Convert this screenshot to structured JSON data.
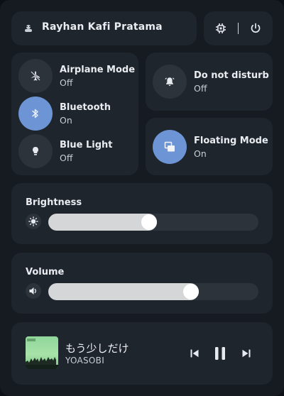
{
  "user": {
    "name": "Rayhan Kafi Pratama",
    "icon": "user-icon"
  },
  "system": {
    "settings_icon": "cpu-icon",
    "power_icon": "power-icon"
  },
  "toggles": [
    {
      "label": "Airplane Mode",
      "state": "Off",
      "icon": "airplane-icon",
      "active": false
    },
    {
      "label": "Bluetooth",
      "state": "On",
      "icon": "bluetooth-icon",
      "active": true
    },
    {
      "label": "Blue Light",
      "state": "Off",
      "icon": "lightbulb-icon",
      "active": false
    }
  ],
  "dnd": {
    "label": "Do not disturb",
    "state": "Off",
    "icon": "bell-icon",
    "active": false
  },
  "floating": {
    "label": "Floating Mode",
    "state": "On",
    "icon": "floating-window-icon",
    "active": true
  },
  "brightness": {
    "label": "Brightness",
    "level": 0.48,
    "icon": "sun-icon"
  },
  "volume": {
    "label": "Volume",
    "level": 0.68,
    "icon": "speaker-icon"
  },
  "media": {
    "title": "もう少しだけ",
    "artist": "YOASOBI",
    "controls": [
      "previous-icon",
      "pause-icon",
      "next-icon"
    ]
  },
  "colors": {
    "accent": "#6d95d6",
    "panel": "#161b21",
    "card": "#1f252c",
    "track": "#2c333b"
  }
}
